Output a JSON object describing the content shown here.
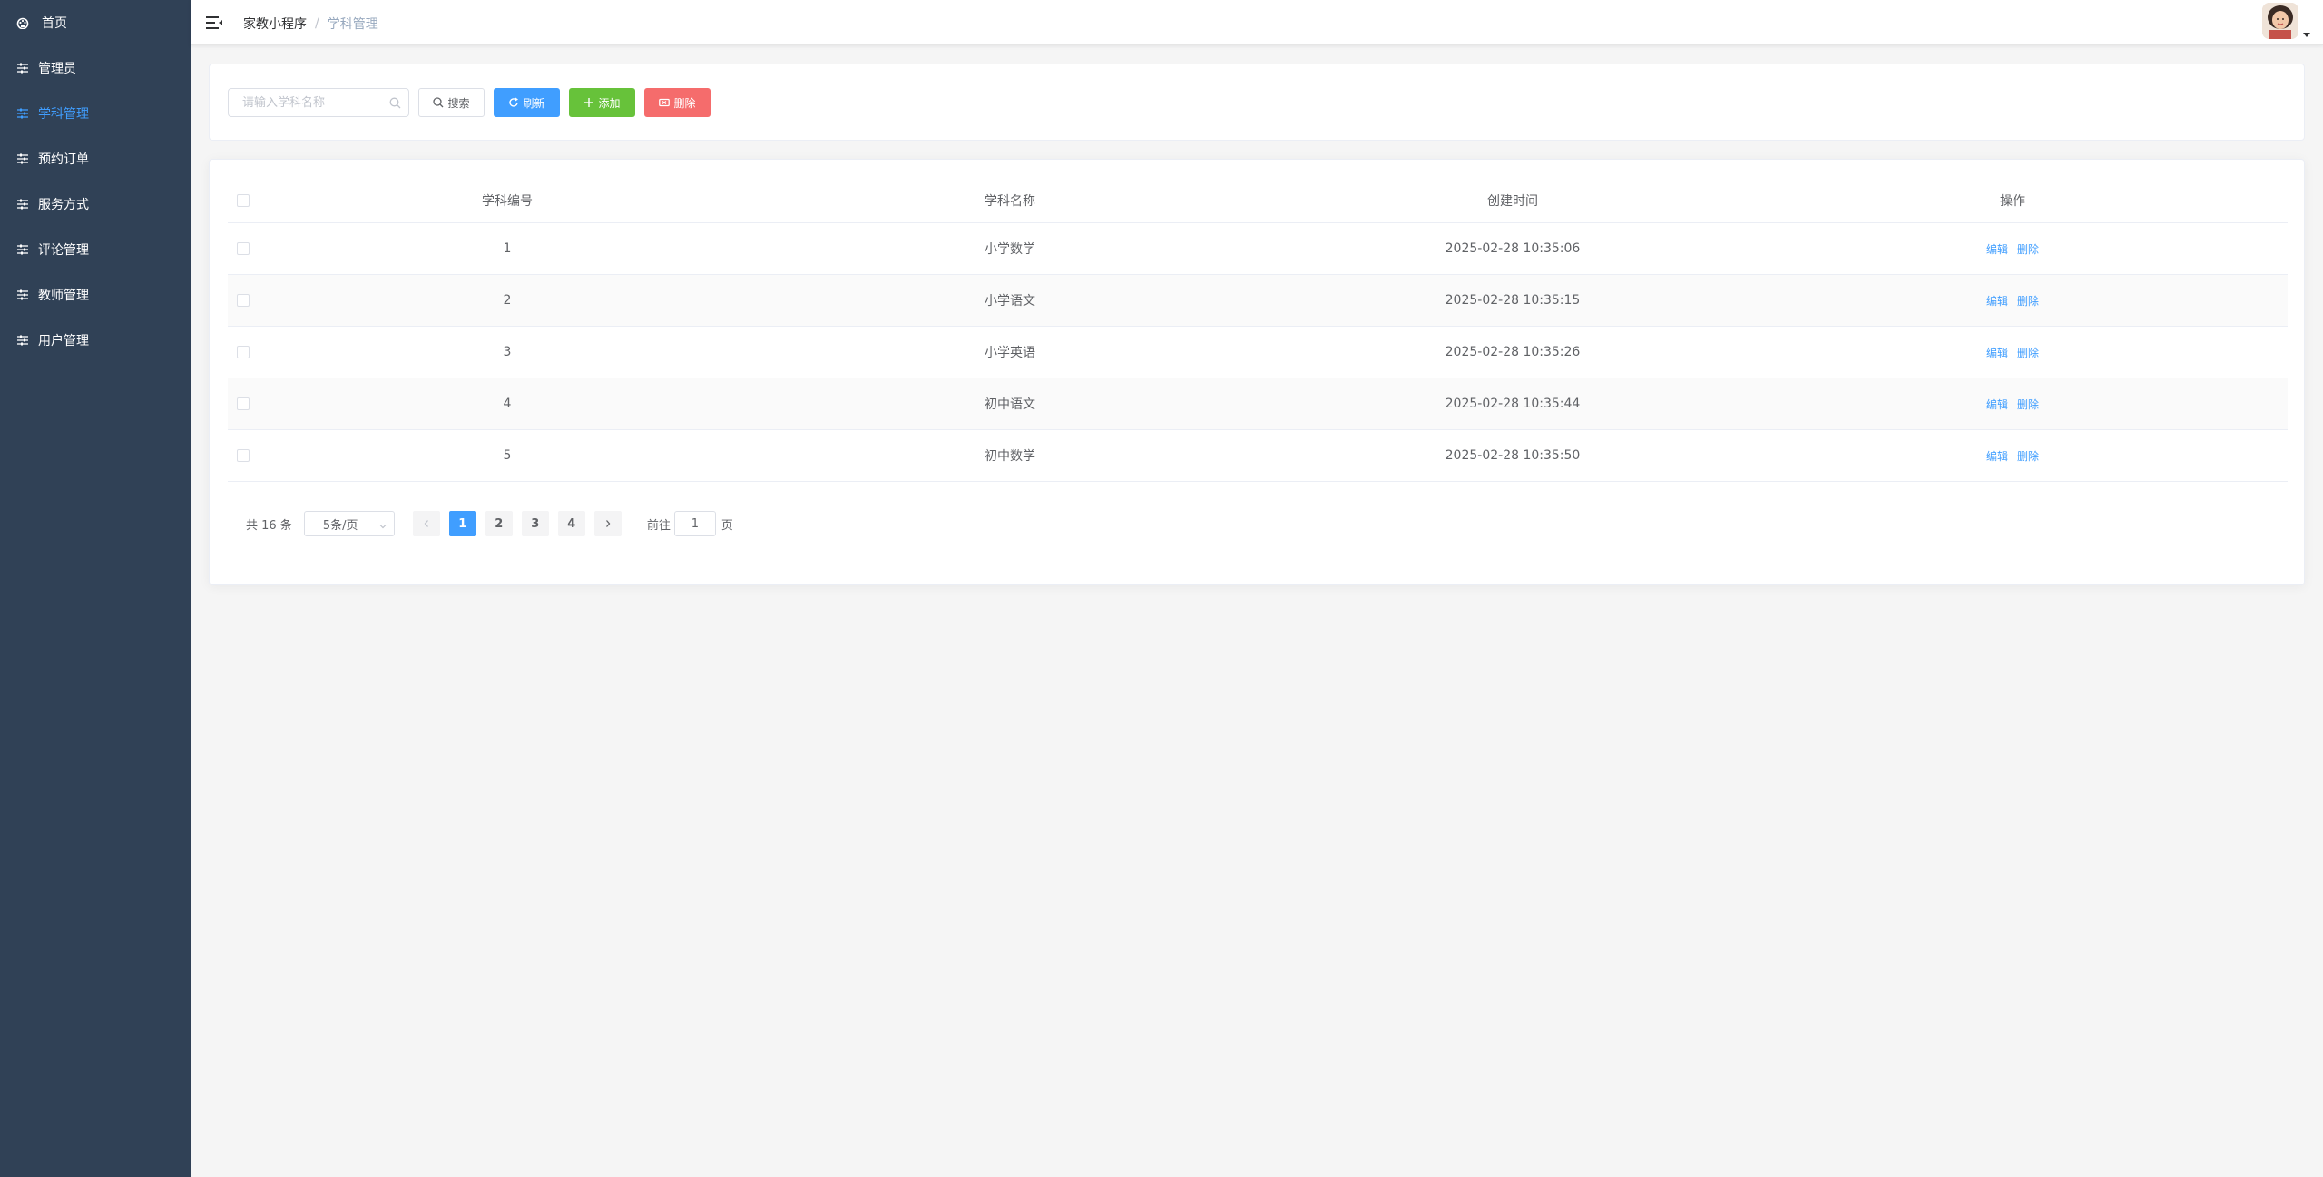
{
  "sidebar": {
    "active_color": "#409eff",
    "background": "#304156",
    "items": [
      {
        "label": "首页",
        "icon": "dashboard-icon"
      },
      {
        "label": "管理员",
        "icon": "sliders-icon"
      },
      {
        "label": "学科管理",
        "icon": "sliders-icon",
        "active": true
      },
      {
        "label": "预约订单",
        "icon": "sliders-icon"
      },
      {
        "label": "服务方式",
        "icon": "sliders-icon"
      },
      {
        "label": "评论管理",
        "icon": "sliders-icon"
      },
      {
        "label": "教师管理",
        "icon": "sliders-icon"
      },
      {
        "label": "用户管理",
        "icon": "sliders-icon"
      }
    ]
  },
  "header": {
    "breadcrumb": {
      "home": "家教小程序",
      "separator": "/",
      "current": "学科管理"
    }
  },
  "toolbar": {
    "search_placeholder": "请输入学科名称",
    "search_label": "搜索",
    "refresh_label": "刷新",
    "add_label": "添加",
    "delete_label": "删除",
    "colors": {
      "primary": "#409eff",
      "success": "#67c23a",
      "danger": "#f56c6c"
    }
  },
  "table": {
    "columns": [
      "学科编号",
      "学科名称",
      "创建时间",
      "操作"
    ],
    "rows": [
      {
        "id": "1",
        "name": "小学数学",
        "created": "2025-02-28 10:35:06"
      },
      {
        "id": "2",
        "name": "小学语文",
        "created": "2025-02-28 10:35:15"
      },
      {
        "id": "3",
        "name": "小学英语",
        "created": "2025-02-28 10:35:26"
      },
      {
        "id": "4",
        "name": "初中语文",
        "created": "2025-02-28 10:35:44"
      },
      {
        "id": "5",
        "name": "初中数学",
        "created": "2025-02-28 10:35:50"
      }
    ],
    "edit_label": "编辑",
    "delete_label": "删除"
  },
  "pagination": {
    "total_text": "共 16 条",
    "page_size": "5条/页",
    "pages": [
      "1",
      "2",
      "3",
      "4"
    ],
    "current_page": "1",
    "jump_prefix": "前往",
    "jump_value": "1",
    "jump_suffix": "页"
  }
}
